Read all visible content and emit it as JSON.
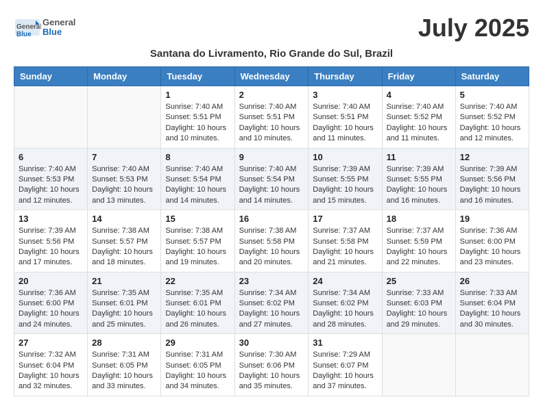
{
  "logo": {
    "general": "General",
    "blue": "Blue"
  },
  "month_title": "July 2025",
  "subtitle": "Santana do Livramento, Rio Grande do Sul, Brazil",
  "headers": [
    "Sunday",
    "Monday",
    "Tuesday",
    "Wednesday",
    "Thursday",
    "Friday",
    "Saturday"
  ],
  "weeks": [
    [
      {
        "day": "",
        "sunrise": "",
        "sunset": "",
        "daylight": "",
        "empty": true
      },
      {
        "day": "",
        "sunrise": "",
        "sunset": "",
        "daylight": "",
        "empty": true
      },
      {
        "day": "1",
        "sunrise": "Sunrise: 7:40 AM",
        "sunset": "Sunset: 5:51 PM",
        "daylight": "Daylight: 10 hours and 10 minutes."
      },
      {
        "day": "2",
        "sunrise": "Sunrise: 7:40 AM",
        "sunset": "Sunset: 5:51 PM",
        "daylight": "Daylight: 10 hours and 10 minutes."
      },
      {
        "day": "3",
        "sunrise": "Sunrise: 7:40 AM",
        "sunset": "Sunset: 5:51 PM",
        "daylight": "Daylight: 10 hours and 11 minutes."
      },
      {
        "day": "4",
        "sunrise": "Sunrise: 7:40 AM",
        "sunset": "Sunset: 5:52 PM",
        "daylight": "Daylight: 10 hours and 11 minutes."
      },
      {
        "day": "5",
        "sunrise": "Sunrise: 7:40 AM",
        "sunset": "Sunset: 5:52 PM",
        "daylight": "Daylight: 10 hours and 12 minutes."
      }
    ],
    [
      {
        "day": "6",
        "sunrise": "Sunrise: 7:40 AM",
        "sunset": "Sunset: 5:53 PM",
        "daylight": "Daylight: 10 hours and 12 minutes."
      },
      {
        "day": "7",
        "sunrise": "Sunrise: 7:40 AM",
        "sunset": "Sunset: 5:53 PM",
        "daylight": "Daylight: 10 hours and 13 minutes."
      },
      {
        "day": "8",
        "sunrise": "Sunrise: 7:40 AM",
        "sunset": "Sunset: 5:54 PM",
        "daylight": "Daylight: 10 hours and 14 minutes."
      },
      {
        "day": "9",
        "sunrise": "Sunrise: 7:40 AM",
        "sunset": "Sunset: 5:54 PM",
        "daylight": "Daylight: 10 hours and 14 minutes."
      },
      {
        "day": "10",
        "sunrise": "Sunrise: 7:39 AM",
        "sunset": "Sunset: 5:55 PM",
        "daylight": "Daylight: 10 hours and 15 minutes."
      },
      {
        "day": "11",
        "sunrise": "Sunrise: 7:39 AM",
        "sunset": "Sunset: 5:55 PM",
        "daylight": "Daylight: 10 hours and 16 minutes."
      },
      {
        "day": "12",
        "sunrise": "Sunrise: 7:39 AM",
        "sunset": "Sunset: 5:56 PM",
        "daylight": "Daylight: 10 hours and 16 minutes."
      }
    ],
    [
      {
        "day": "13",
        "sunrise": "Sunrise: 7:39 AM",
        "sunset": "Sunset: 5:56 PM",
        "daylight": "Daylight: 10 hours and 17 minutes."
      },
      {
        "day": "14",
        "sunrise": "Sunrise: 7:38 AM",
        "sunset": "Sunset: 5:57 PM",
        "daylight": "Daylight: 10 hours and 18 minutes."
      },
      {
        "day": "15",
        "sunrise": "Sunrise: 7:38 AM",
        "sunset": "Sunset: 5:57 PM",
        "daylight": "Daylight: 10 hours and 19 minutes."
      },
      {
        "day": "16",
        "sunrise": "Sunrise: 7:38 AM",
        "sunset": "Sunset: 5:58 PM",
        "daylight": "Daylight: 10 hours and 20 minutes."
      },
      {
        "day": "17",
        "sunrise": "Sunrise: 7:37 AM",
        "sunset": "Sunset: 5:58 PM",
        "daylight": "Daylight: 10 hours and 21 minutes."
      },
      {
        "day": "18",
        "sunrise": "Sunrise: 7:37 AM",
        "sunset": "Sunset: 5:59 PM",
        "daylight": "Daylight: 10 hours and 22 minutes."
      },
      {
        "day": "19",
        "sunrise": "Sunrise: 7:36 AM",
        "sunset": "Sunset: 6:00 PM",
        "daylight": "Daylight: 10 hours and 23 minutes."
      }
    ],
    [
      {
        "day": "20",
        "sunrise": "Sunrise: 7:36 AM",
        "sunset": "Sunset: 6:00 PM",
        "daylight": "Daylight: 10 hours and 24 minutes."
      },
      {
        "day": "21",
        "sunrise": "Sunrise: 7:35 AM",
        "sunset": "Sunset: 6:01 PM",
        "daylight": "Daylight: 10 hours and 25 minutes."
      },
      {
        "day": "22",
        "sunrise": "Sunrise: 7:35 AM",
        "sunset": "Sunset: 6:01 PM",
        "daylight": "Daylight: 10 hours and 26 minutes."
      },
      {
        "day": "23",
        "sunrise": "Sunrise: 7:34 AM",
        "sunset": "Sunset: 6:02 PM",
        "daylight": "Daylight: 10 hours and 27 minutes."
      },
      {
        "day": "24",
        "sunrise": "Sunrise: 7:34 AM",
        "sunset": "Sunset: 6:02 PM",
        "daylight": "Daylight: 10 hours and 28 minutes."
      },
      {
        "day": "25",
        "sunrise": "Sunrise: 7:33 AM",
        "sunset": "Sunset: 6:03 PM",
        "daylight": "Daylight: 10 hours and 29 minutes."
      },
      {
        "day": "26",
        "sunrise": "Sunrise: 7:33 AM",
        "sunset": "Sunset: 6:04 PM",
        "daylight": "Daylight: 10 hours and 30 minutes."
      }
    ],
    [
      {
        "day": "27",
        "sunrise": "Sunrise: 7:32 AM",
        "sunset": "Sunset: 6:04 PM",
        "daylight": "Daylight: 10 hours and 32 minutes."
      },
      {
        "day": "28",
        "sunrise": "Sunrise: 7:31 AM",
        "sunset": "Sunset: 6:05 PM",
        "daylight": "Daylight: 10 hours and 33 minutes."
      },
      {
        "day": "29",
        "sunrise": "Sunrise: 7:31 AM",
        "sunset": "Sunset: 6:05 PM",
        "daylight": "Daylight: 10 hours and 34 minutes."
      },
      {
        "day": "30",
        "sunrise": "Sunrise: 7:30 AM",
        "sunset": "Sunset: 6:06 PM",
        "daylight": "Daylight: 10 hours and 35 minutes."
      },
      {
        "day": "31",
        "sunrise": "Sunrise: 7:29 AM",
        "sunset": "Sunset: 6:07 PM",
        "daylight": "Daylight: 10 hours and 37 minutes."
      },
      {
        "day": "",
        "sunrise": "",
        "sunset": "",
        "daylight": "",
        "empty": true
      },
      {
        "day": "",
        "sunrise": "",
        "sunset": "",
        "daylight": "",
        "empty": true
      }
    ]
  ]
}
